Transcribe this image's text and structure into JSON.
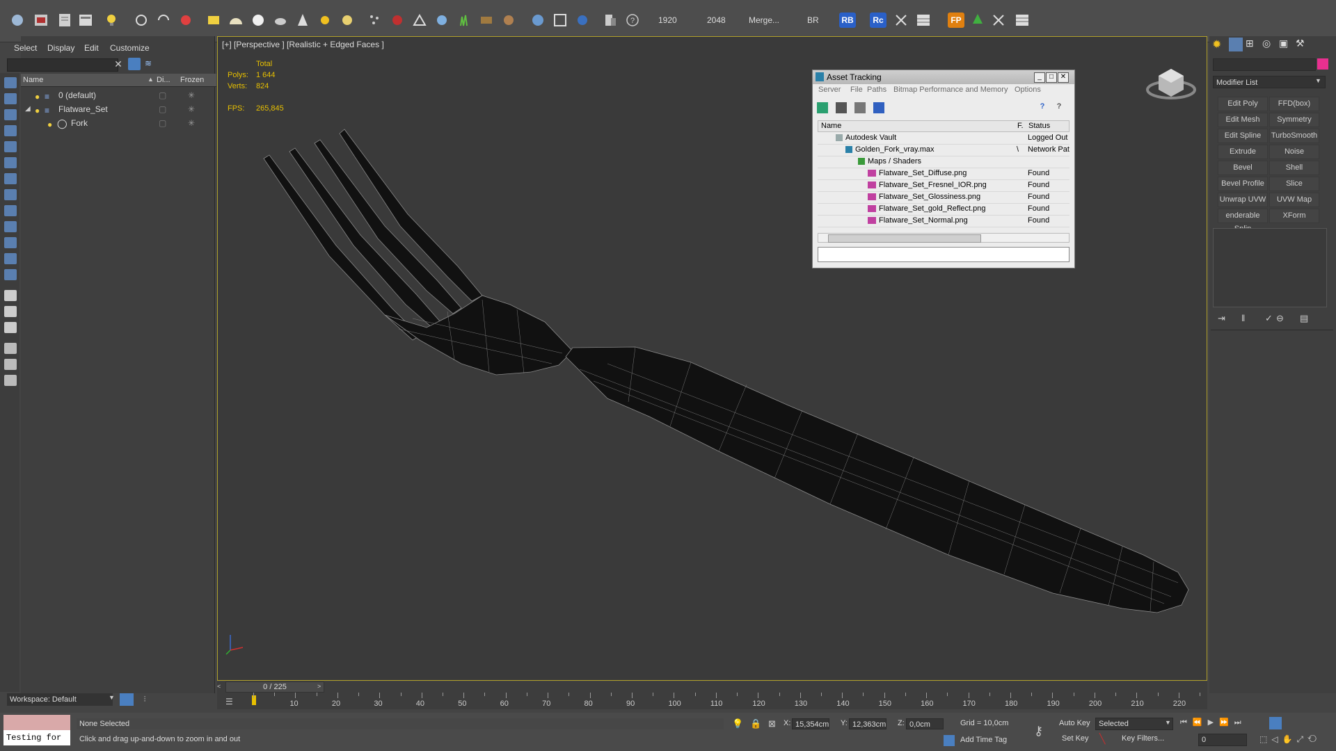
{
  "toolbar": {
    "numbers": [
      "1920",
      "2048"
    ],
    "merge_label": "Merge...",
    "br_label": "BR",
    "rb_label": "RB",
    "rc_label": "Rc",
    "fp_label": "FP"
  },
  "scene_explorer": {
    "menus": [
      "Select",
      "Display",
      "Edit",
      "Customize"
    ],
    "columns": [
      "Name",
      "Di...",
      "Frozen"
    ],
    "rows": [
      {
        "name": "0 (default)"
      },
      {
        "name": "Flatware_Set"
      },
      {
        "name": "Fork"
      }
    ],
    "workspace_label": "Workspace: Default"
  },
  "viewport": {
    "label": "[+] [Perspective ] [Realistic + Edged Faces ]",
    "stats_total": "Total",
    "polys_label": "Polys:",
    "polys_value": "1 644",
    "verts_label": "Verts:",
    "verts_value": "824",
    "fps_label": "FPS:",
    "fps_value": "265,845"
  },
  "asset_tracking": {
    "title": "Asset Tracking",
    "menus": [
      "Server",
      "File",
      "Paths",
      "Bitmap Performance and Memory",
      "Options"
    ],
    "columns": [
      "Name",
      "F.",
      "Status"
    ],
    "rows": [
      {
        "name": "Autodesk Vault",
        "f": "",
        "status": "Logged Out"
      },
      {
        "name": "Golden_Fork_vray.max",
        "f": "\\",
        "status": "Network Pat"
      },
      {
        "name": "Maps / Shaders",
        "f": "",
        "status": ""
      },
      {
        "name": "Flatware_Set_Diffuse.png",
        "f": "",
        "status": "Found"
      },
      {
        "name": "Flatware_Set_Fresnel_IOR.png",
        "f": "",
        "status": "Found"
      },
      {
        "name": "Flatware_Set_Glossiness.png",
        "f": "",
        "status": "Found"
      },
      {
        "name": "Flatware_Set_gold_Reflect.png",
        "f": "",
        "status": "Found"
      },
      {
        "name": "Flatware_Set_Normal.png",
        "f": "",
        "status": "Found"
      }
    ]
  },
  "command_panel": {
    "modifier_list": "Modifier List",
    "buttons": [
      "Edit Poly",
      "FFD(box)",
      "Edit Mesh",
      "Symmetry",
      "Edit Spline",
      "TurboSmooth",
      "Extrude",
      "Noise",
      "Bevel",
      "Shell",
      "Bevel Profile",
      "Slice",
      "Unwrap UVW",
      "UVW Map",
      "enderable Splin",
      "XForm"
    ]
  },
  "timeline": {
    "frame_display": "0 / 225",
    "ticks": [
      "10",
      "20",
      "30",
      "40",
      "50",
      "60",
      "70",
      "80",
      "90",
      "100",
      "110",
      "120",
      "130",
      "140",
      "150",
      "160",
      "170",
      "180",
      "190",
      "200",
      "210",
      "220"
    ]
  },
  "status_bar": {
    "script_text": "Testing for :",
    "selection": "None Selected",
    "prompt": "Click and drag up-and-down to zoom in and out",
    "x_label": "X:",
    "x_value": "15,354cm",
    "y_label": "Y:",
    "y_value": "12,363cm",
    "z_label": "Z:",
    "z_value": "0,0cm",
    "grid": "Grid = 10,0cm",
    "add_time_tag": "Add Time Tag",
    "auto_key": "Auto Key",
    "set_key": "Set Key",
    "selected_dropdown": "Selected",
    "key_filters": "Key Filters...",
    "frame_value": "0"
  },
  "colors": {
    "accent": "#e8c000",
    "viewport_bg": "#3a3a3a",
    "panel_bg": "#3f3f3f",
    "mesh_fill": "#111111",
    "mesh_wire": "#8a8a8a"
  }
}
